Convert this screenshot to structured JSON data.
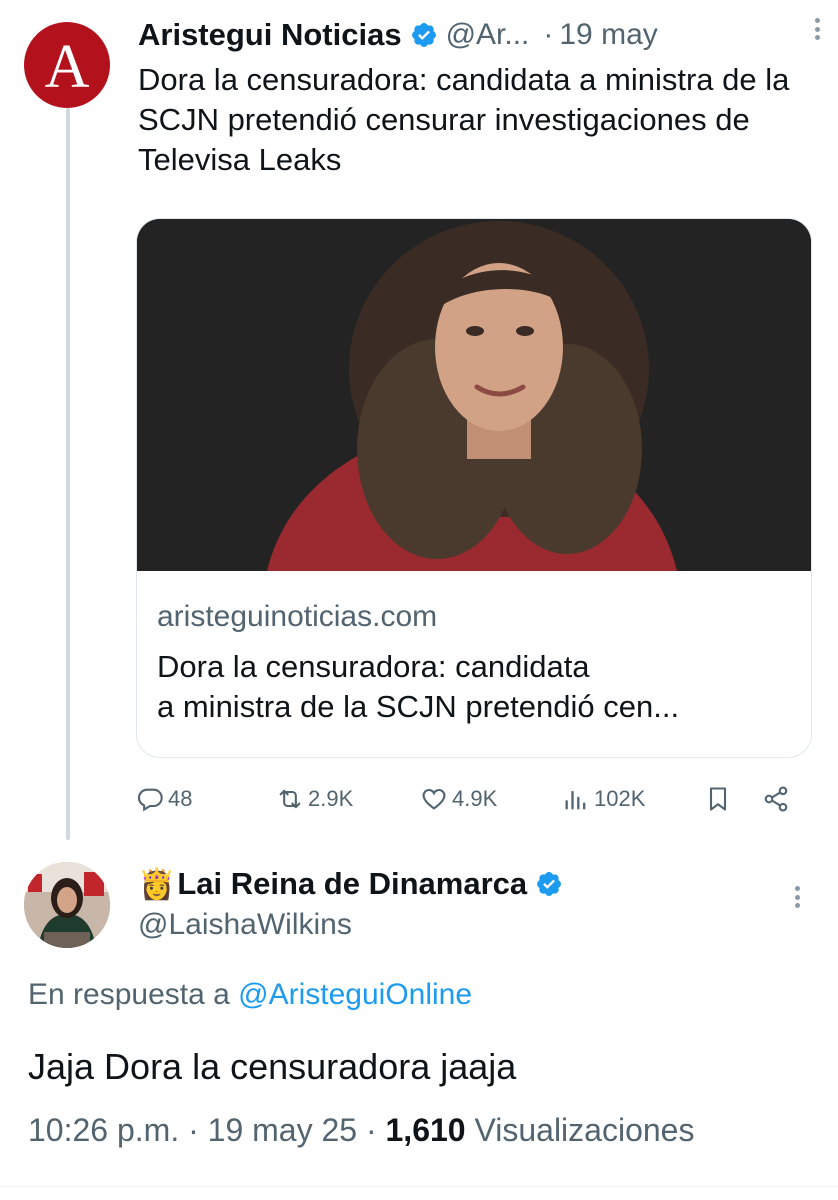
{
  "tweet1": {
    "author_name": "Aristegui Noticias",
    "handle": "@Ar...",
    "separator": "·",
    "date": "19 may",
    "avatar_letter": "A",
    "text": "Dora la censuradora: candidata a ministra de la SCJN pretendió censurar investigaciones de Televisa Leaks",
    "card": {
      "domain": "aristeguinoticias.com",
      "title_line1": "Dora la censuradora: candidata",
      "title_line2": "a ministra de la SCJN pretendió cen..."
    },
    "actions": {
      "replies": "48",
      "reposts": "2.9K",
      "likes": "4.9K",
      "views": "102K"
    }
  },
  "tweet2": {
    "crown_emoji": "👸",
    "author_name": "Lai Reina de Dinamarca",
    "handle": "@LaishaWilkins",
    "reply_prefix": "En respuesta a",
    "reply_handle": "@AristeguiOnline",
    "text": "Jaja Dora la censuradora jaaja",
    "time": "10:26 p.m.",
    "sep1": "·",
    "date": "19 may 25",
    "sep2": "·",
    "views_count": "1,610",
    "views_label": "Visualizaciones"
  },
  "colors": {
    "text_primary": "#0f1419",
    "text_secondary": "#536471",
    "link": "#1d9bf0",
    "verified": "#1d9bf0",
    "brand_red": "#b3121c",
    "thread_line": "#cfd9de"
  },
  "icons": [
    "verified-badge-icon",
    "more-icon",
    "reply-icon",
    "repost-icon",
    "like-icon",
    "views-icon",
    "bookmark-icon",
    "share-icon"
  ]
}
